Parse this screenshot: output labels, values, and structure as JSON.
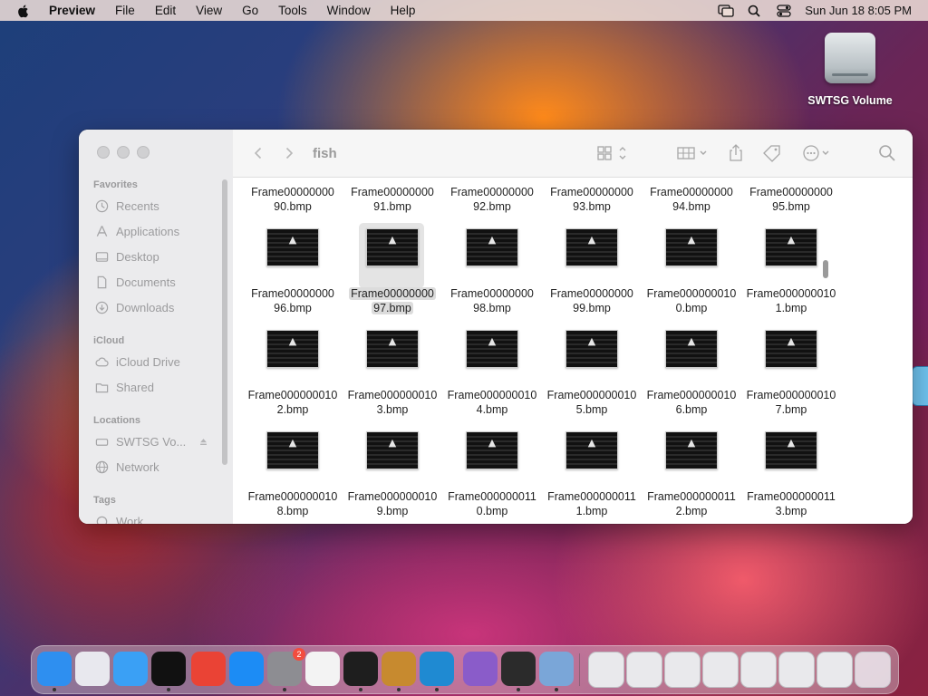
{
  "menubar": {
    "app_name": "Preview",
    "menus": [
      "File",
      "Edit",
      "View",
      "Go",
      "Tools",
      "Window",
      "Help"
    ],
    "clock": "Sun Jun 18  8:05 PM"
  },
  "desktop": {
    "volume_label": "SWTSG Volume"
  },
  "finder": {
    "title": "fish",
    "sidebar": {
      "favorites_header": "Favorites",
      "favorites": [
        "Recents",
        "Applications",
        "Desktop",
        "Documents",
        "Downloads"
      ],
      "icloud_header": "iCloud",
      "icloud": [
        "iCloud Drive",
        "Shared"
      ],
      "locations_header": "Locations",
      "locations": [
        "SWTSG Vo...",
        "Network"
      ],
      "tags_header": "Tags",
      "tags": [
        "Work"
      ]
    },
    "files": [
      {
        "line1": "Frame00000000",
        "line2": "90.bmp",
        "thumb": false
      },
      {
        "line1": "Frame00000000",
        "line2": "91.bmp",
        "thumb": false
      },
      {
        "line1": "Frame00000000",
        "line2": "92.bmp",
        "thumb": false
      },
      {
        "line1": "Frame00000000",
        "line2": "93.bmp",
        "thumb": false
      },
      {
        "line1": "Frame00000000",
        "line2": "94.bmp",
        "thumb": false
      },
      {
        "line1": "Frame00000000",
        "line2": "95.bmp",
        "thumb": false
      },
      {
        "line1": "Frame00000000",
        "line2": "96.bmp",
        "thumb": true
      },
      {
        "line1": "Frame00000000",
        "line2": "97.bmp",
        "thumb": true,
        "selected": true
      },
      {
        "line1": "Frame00000000",
        "line2": "98.bmp",
        "thumb": true
      },
      {
        "line1": "Frame00000000",
        "line2": "99.bmp",
        "thumb": true
      },
      {
        "line1": "Frame000000010",
        "line2": "0.bmp",
        "thumb": true
      },
      {
        "line1": "Frame000000010",
        "line2": "1.bmp",
        "thumb": true
      },
      {
        "line1": "Frame000000010",
        "line2": "2.bmp",
        "thumb": true
      },
      {
        "line1": "Frame000000010",
        "line2": "3.bmp",
        "thumb": true
      },
      {
        "line1": "Frame000000010",
        "line2": "4.bmp",
        "thumb": true
      },
      {
        "line1": "Frame000000010",
        "line2": "5.bmp",
        "thumb": true
      },
      {
        "line1": "Frame000000010",
        "line2": "6.bmp",
        "thumb": true
      },
      {
        "line1": "Frame000000010",
        "line2": "7.bmp",
        "thumb": true
      },
      {
        "line1": "Frame000000010",
        "line2": "8.bmp",
        "thumb": true
      },
      {
        "line1": "Frame000000010",
        "line2": "9.bmp",
        "thumb": true
      },
      {
        "line1": "Frame000000011",
        "line2": "0.bmp",
        "thumb": true
      },
      {
        "line1": "Frame000000011",
        "line2": "1.bmp",
        "thumb": true
      },
      {
        "line1": "Frame000000011",
        "line2": "2.bmp",
        "thumb": true
      },
      {
        "line1": "Frame000000011",
        "line2": "3.bmp",
        "thumb": true
      }
    ]
  },
  "dock": {
    "items": [
      {
        "name": "finder",
        "color": "#2e8ff0",
        "running": true
      },
      {
        "name": "launchpad",
        "color": "#e8e8ee",
        "running": false
      },
      {
        "name": "safari",
        "color": "#3aa0f5",
        "running": false
      },
      {
        "name": "preview-window",
        "color": "#111111",
        "running": true
      },
      {
        "name": "chrome",
        "color": "#ea4335",
        "running": false
      },
      {
        "name": "app-store",
        "color": "#1c8cf5",
        "running": false
      },
      {
        "name": "system-settings",
        "color": "#8d8d92",
        "running": true,
        "badge": "2"
      },
      {
        "name": "textedit",
        "color": "#f3f3f3",
        "running": false
      },
      {
        "name": "terminal",
        "color": "#1e1e1e",
        "running": true
      },
      {
        "name": "instruments",
        "color": "#c78a2f",
        "running": true
      },
      {
        "name": "vscode",
        "color": "#1f8ad2",
        "running": true
      },
      {
        "name": "visual-studio",
        "color": "#8a5cc9",
        "running": false
      },
      {
        "name": "xcode-scribble",
        "color": "#2b2b2b",
        "running": true
      },
      {
        "name": "preview",
        "color": "#7aa6d8",
        "running": true
      }
    ],
    "recent_items": [
      "recent-doc-1",
      "recent-doc-2",
      "recent-doc-3",
      "recent-doc-4",
      "recent-doc-5",
      "recent-doc-6",
      "recent-doc-7"
    ],
    "trash": "trash"
  }
}
